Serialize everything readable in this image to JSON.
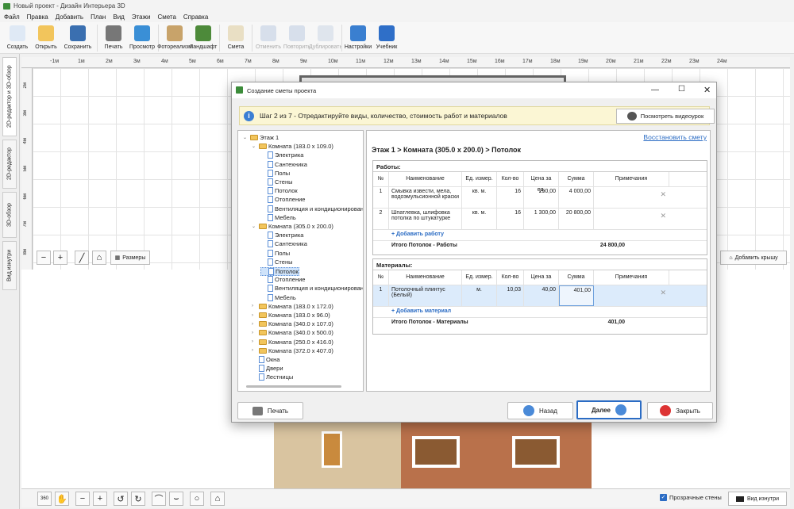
{
  "app": {
    "title": "Новый проект - Дизайн Интерьера 3D"
  },
  "menu": [
    "Файл",
    "Правка",
    "Добавить",
    "План",
    "Вид",
    "Этажи",
    "Смета",
    "Справка"
  ],
  "toolbar": [
    {
      "label": "Создать",
      "icon": "new-file-icon",
      "color": "#dfe9f5"
    },
    {
      "label": "Открыть",
      "icon": "folder-icon",
      "color": "#f2c55c"
    },
    {
      "label": "Сохранить",
      "icon": "floppy-icon",
      "color": "#3a6fb0"
    },
    {
      "label": "Печать",
      "icon": "printer-icon",
      "color": "#777"
    },
    {
      "label": "Просмотр",
      "icon": "monitor-icon",
      "color": "#3a8fd6"
    },
    {
      "label": "Фотореализм",
      "icon": "photo-icon",
      "color": "#c8a36a"
    },
    {
      "label": "Ландшафт",
      "icon": "tree-icon",
      "color": "#4d8a3a"
    },
    {
      "label": "Смета",
      "icon": "estimate-icon",
      "color": "#e9dfc4"
    },
    {
      "label": "Отменить",
      "icon": "undo-icon",
      "color": "#b8c8e0",
      "disabled": true
    },
    {
      "label": "Повторить",
      "icon": "redo-icon",
      "color": "#b8c8e0",
      "disabled": true
    },
    {
      "label": "Дублировать",
      "icon": "duplicate-icon",
      "color": "#c8d4e4",
      "disabled": true
    },
    {
      "label": "Настройки",
      "icon": "gear-icon",
      "color": "#3a7fd0"
    },
    {
      "label": "Учебник",
      "icon": "help-icon",
      "color": "#2f6fc8"
    }
  ],
  "left_tabs": [
    "2D-редактор и 3D-обзор",
    "2D-редактор",
    "3D-обзор",
    "Вид изнутри"
  ],
  "ruler_h": [
    "-1м",
    "1м",
    "2м",
    "3м",
    "4м",
    "5м",
    "6м",
    "7м",
    "8м",
    "9м",
    "10м",
    "11м",
    "12м",
    "13м",
    "14м",
    "15м",
    "16м",
    "17м",
    "18м",
    "19м",
    "20м",
    "21м",
    "22м",
    "23м",
    "24м"
  ],
  "ruler_v": [
    "2м",
    "3м",
    "4м",
    "5м",
    "6м",
    "7м",
    "8м"
  ],
  "plan_toolbar": {
    "sizes": "Размеры",
    "add_roof": "Добавить крышу"
  },
  "bottom": {
    "transparent": "Прозрачные стены",
    "inside": "Вид изнутри",
    "zoom_label": "360"
  },
  "dialog": {
    "title": "Создание сметы проекта",
    "step": "Шаг 2 из 7 - Отредактируйте виды, количество, стоимость работ и материалов",
    "video": "Посмотреть видеоурок",
    "restore": "Восстановить смету",
    "breadcrumb": "Этаж 1 > Комната (305.0 x 200.0) > Потолок",
    "print": "Печать",
    "back": "Назад",
    "next": "Далее",
    "close": "Закрыть"
  },
  "tree": [
    {
      "t": "Этаж 1",
      "lvl": 0,
      "type": "folder",
      "exp": true
    },
    {
      "t": "Комната (183.0 x 109.0)",
      "lvl": 1,
      "type": "folder",
      "exp": true
    },
    {
      "t": "Электрика",
      "lvl": 2,
      "type": "leaf"
    },
    {
      "t": "Сантехника",
      "lvl": 2,
      "type": "leaf"
    },
    {
      "t": "Полы",
      "lvl": 2,
      "type": "leaf"
    },
    {
      "t": "Стены",
      "lvl": 2,
      "type": "leaf"
    },
    {
      "t": "Потолок",
      "lvl": 2,
      "type": "leaf"
    },
    {
      "t": "Отопление",
      "lvl": 2,
      "type": "leaf"
    },
    {
      "t": "Вентиляция и кондиционирование",
      "lvl": 2,
      "type": "leaf"
    },
    {
      "t": "Мебель",
      "lvl": 2,
      "type": "leaf"
    },
    {
      "t": "Комната (305.0 x 200.0)",
      "lvl": 1,
      "type": "folder",
      "exp": true
    },
    {
      "t": "Электрика",
      "lvl": 2,
      "type": "leaf"
    },
    {
      "t": "Сантехника",
      "lvl": 2,
      "type": "leaf"
    },
    {
      "t": "Полы",
      "lvl": 2,
      "type": "leaf"
    },
    {
      "t": "Стены",
      "lvl": 2,
      "type": "leaf"
    },
    {
      "t": "Потолок",
      "lvl": 2,
      "type": "leaf",
      "selected": true
    },
    {
      "t": "Отопление",
      "lvl": 2,
      "type": "leaf"
    },
    {
      "t": "Вентиляция и кондиционирование",
      "lvl": 2,
      "type": "leaf"
    },
    {
      "t": "Мебель",
      "lvl": 2,
      "type": "leaf"
    },
    {
      "t": "Комната (183.0 x 172.0)",
      "lvl": 1,
      "type": "folder"
    },
    {
      "t": "Комната (183.0 x 96.0)",
      "lvl": 1,
      "type": "folder"
    },
    {
      "t": "Комната (340.0 x 107.0)",
      "lvl": 1,
      "type": "folder"
    },
    {
      "t": "Комната (340.0 x 500.0)",
      "lvl": 1,
      "type": "folder"
    },
    {
      "t": "Комната (250.0 x 416.0)",
      "lvl": 1,
      "type": "folder"
    },
    {
      "t": "Комната (372.0 x 407.0)",
      "lvl": 1,
      "type": "folder"
    },
    {
      "t": "Окна",
      "lvl": 1,
      "type": "leaf"
    },
    {
      "t": "Двери",
      "lvl": 1,
      "type": "leaf"
    },
    {
      "t": "Лестницы",
      "lvl": 1,
      "type": "leaf"
    }
  ],
  "columns": [
    "№",
    "Наименование",
    "Ед. измер.",
    "Кол-во",
    "Цена за ед.",
    "Сумма",
    "Примечания"
  ],
  "works": {
    "header": "Работы:",
    "rows": [
      {
        "n": "1",
        "name": "Смывка извести, мела, водоэмульсионной краски",
        "unit": "кв. м.",
        "qty": "16",
        "price": "250,00",
        "sum": "4 000,00"
      },
      {
        "n": "2",
        "name": "Шпатлевка, шлифовка потолка по штукатурке",
        "unit": "кв. м.",
        "qty": "16",
        "price": "1 300,00",
        "sum": "20 800,00"
      }
    ],
    "add": "+ Добавить работу",
    "total_label": "Итого Потолок - Работы",
    "total": "24 800,00"
  },
  "materials": {
    "header": "Материалы:",
    "rows": [
      {
        "n": "1",
        "name": "Потолочный плинтус (Белый)",
        "unit": "м.",
        "qty": "10,03",
        "price": "40,00",
        "sum": "401,00"
      }
    ],
    "add": "+ Добавить материал",
    "total_label": "Итого Потолок - Материалы",
    "total": "401,00"
  }
}
